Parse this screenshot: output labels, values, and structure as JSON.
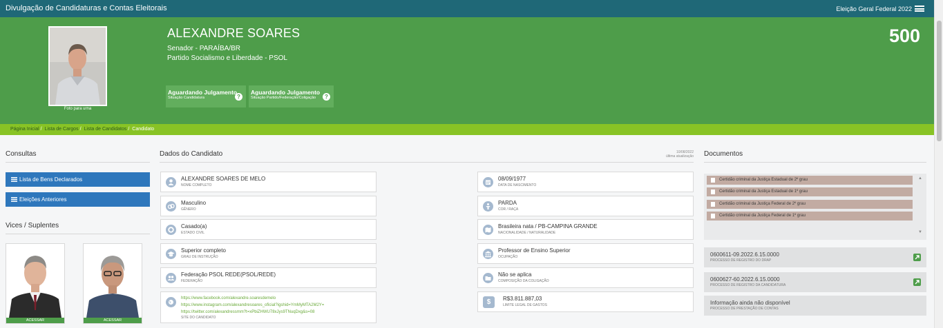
{
  "topbar": {
    "title": "Divulgação de Candidaturas e Contas Eleitorais",
    "election": "Eleição Geral Federal 2022"
  },
  "candidate": {
    "name": "ALEXANDRE SOARES",
    "role": "Senador - PARAÍBA/BR",
    "party": "Partido Socialismo e Liberdade - PSOL",
    "number": "500",
    "photo_caption": "Foto para urna",
    "statuses": [
      {
        "title": "Aguardando Julgamento",
        "subtitle": "Situação Candidatura"
      },
      {
        "title": "Aguardando Julgamento",
        "subtitle": "Situação Partido/Federação/Coligação"
      }
    ]
  },
  "breadcrumb": [
    "Página Inicial",
    "Lista de Cargos",
    "Lista de Candidatos",
    "Candidato"
  ],
  "consultas": {
    "heading": "Consultas",
    "buttons": [
      "Lista de Bens Declarados",
      "Eleições Anteriores"
    ]
  },
  "vices": {
    "heading": "Vices / Suplentes",
    "access_label": "ACESSAR"
  },
  "dados": {
    "heading": "Dados do Candidato",
    "updated_date": "10/08/2022",
    "updated_label": "última atualização",
    "left": [
      {
        "value": "ALEXANDRE SOARES DE MELO",
        "label": "NOME COMPLETO",
        "icon": "person-icon"
      },
      {
        "value": "Masculino",
        "label": "GÊNERO",
        "icon": "gender-icon"
      },
      {
        "value": "Casado(a)",
        "label": "ESTADO CIVIL",
        "icon": "ring-icon"
      },
      {
        "value": "Superior completo",
        "label": "GRAU DE INSTRUÇÃO",
        "icon": "graduation-cap-icon"
      },
      {
        "value": "Federação PSOL REDE(PSOL/REDE)",
        "label": "FEDERAÇÃO",
        "icon": "people-icon"
      }
    ],
    "right": [
      {
        "value": "08/09/1977",
        "label": "DATA DE NASCIMENTO",
        "icon": "calendar-icon"
      },
      {
        "value": "PARDA",
        "label": "COR / RAÇA",
        "icon": "person-silhouette-icon"
      },
      {
        "value": "Brasileira nata / PB-CAMPINA GRANDE",
        "label": "NACIONALIDADE / NATURALIDADE",
        "icon": "map-icon"
      },
      {
        "value": "Professor de Ensino Superior",
        "label": "OCUPAÇÃO",
        "icon": "bank-icon"
      },
      {
        "value": "Não se aplica",
        "label": "COMPOSIÇÃO DA COLIGAÇÃO",
        "icon": "folder-icon"
      }
    ],
    "sites": {
      "links": [
        "https://www.facebook.com/alexandre.soaresdemelo",
        "https://www.instagram.com/alexandresoares_oficial?igshid=YmMyMTA2M2Y=",
        "https://twitter.com/alexandressmm?t=xPbiZHWU78xJys9TNuqDxg&s=08"
      ],
      "label": "SITE DO CANDIDATO",
      "icon": "globe-icon"
    },
    "limit": {
      "value": "R$3.811.887,03",
      "label": "LIMITE LEGAL DE GASTOS",
      "icon": "dollar-icon",
      "symbol": "$"
    }
  },
  "documentos": {
    "heading": "Documentos",
    "certidoes": [
      "Certidão criminal da Justiça Estadual de 2º grau",
      "Certidão criminal da Justiça Estadual de 1º grau",
      "Certidão criminal da Justiça Federal de 2º grau",
      "Certidão criminal da Justiça Federal de 1º grau"
    ],
    "processos": [
      {
        "value": "0600611-09.2022.6.15.0000",
        "label": "PROCESSO DE REGISTRO DO DRAP"
      },
      {
        "value": "0600627-60.2022.6.15.0000",
        "label": "PROCESSO DE REGISTRO DA CANDIDATURA"
      },
      {
        "value": "Informação ainda não disponível",
        "label": "PROCESSO DE PRESTAÇÃO DE CONTAS"
      }
    ]
  },
  "colors": {
    "topbar": "#1f6877",
    "hero": "#4e9d4a",
    "breadcrumb": "#88c325",
    "button": "#2e77bc",
    "certidao": "#c2aba2"
  }
}
